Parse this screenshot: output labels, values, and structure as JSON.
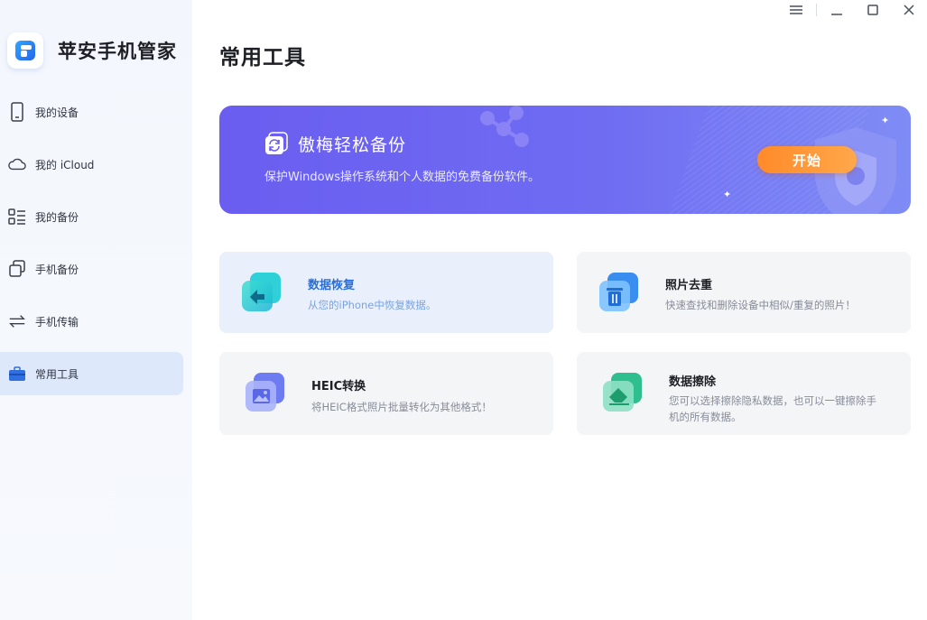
{
  "app": {
    "name": "苹安手机管家"
  },
  "sidebar": {
    "items": [
      {
        "label": "我的设备",
        "icon": "phone-icon",
        "active": false
      },
      {
        "label": "我的 iCloud",
        "icon": "cloud-icon",
        "active": false
      },
      {
        "label": "我的备份",
        "icon": "backup-list-icon",
        "active": false
      },
      {
        "label": "手机备份",
        "icon": "copy-icon",
        "active": false
      },
      {
        "label": "手机传输",
        "icon": "transfer-icon",
        "active": false
      },
      {
        "label": "常用工具",
        "icon": "toolbox-icon",
        "active": true
      }
    ]
  },
  "window_controls": [
    "menu-icon",
    "minimize-icon",
    "maximize-icon",
    "close-icon"
  ],
  "main": {
    "title": "常用工具",
    "banner": {
      "title": "傲梅轻松备份",
      "subtitle": "保护Windows操作系统和个人数据的免费备份软件。",
      "button_label": "开始",
      "accent": "#6a5df0",
      "button_color": "#ff8a2a"
    },
    "tools": [
      {
        "title": "数据恢复",
        "desc": "从您的iPhone中恢复数据。",
        "icon": "data-recovery-icon"
      },
      {
        "title": "照片去重",
        "desc": "快速查找和删除设备中相似/重复的照片！",
        "icon": "photo-dedup-icon"
      },
      {
        "title": "HEIC转换",
        "desc": "将HEIC格式照片批量转化为其他格式！",
        "icon": "heic-convert-icon"
      },
      {
        "title": "数据擦除",
        "desc_line1": "您可以选择擦除隐私数据，也可以一键擦除手",
        "desc_line2": "机的所有数据。",
        "icon": "data-erase-icon"
      }
    ]
  }
}
